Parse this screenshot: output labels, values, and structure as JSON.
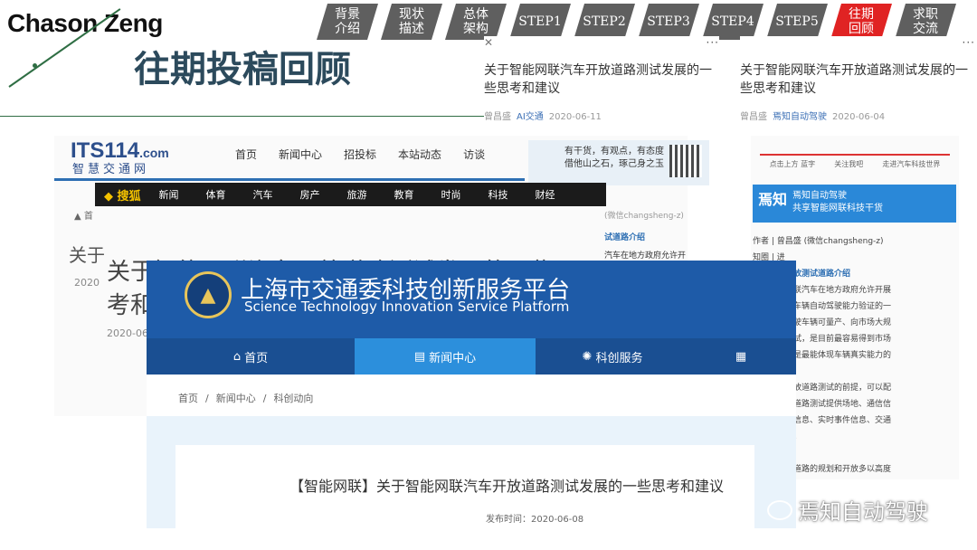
{
  "header": {
    "author": "Chason Zeng",
    "title": "往期投稿回顾"
  },
  "nav": {
    "tabs": [
      {
        "label": "背景\n介绍"
      },
      {
        "label": "现状\n描述"
      },
      {
        "label": "总体\n架构"
      },
      {
        "label": "STEP1"
      },
      {
        "label": "STEP2"
      },
      {
        "label": "STEP3"
      },
      {
        "label": "STEP4"
      },
      {
        "label": "STEP5"
      },
      {
        "label": "往期\n回顾",
        "active": true
      },
      {
        "label": "求职\n交流"
      }
    ],
    "active_color": "#e02323"
  },
  "top_cards": [
    {
      "title": "关于智能网联汽车开放道路测试发展的一些思考和建议",
      "author": "曾昌盛",
      "source": "AI交通",
      "date": "2020-06-11"
    },
    {
      "title": "关于智能网联汽车开放道路测试发展的一些思考和建议",
      "author": "曾昌盛",
      "source": "焉知自动驾驶",
      "date": "2020-06-04"
    }
  ],
  "its114": {
    "logo": "ITS114",
    "logo_suffix": ".com",
    "logo_cn": "智慧交通网",
    "menu": [
      "首页",
      "新闻中心",
      "招投标",
      "本站动态",
      "访谈"
    ],
    "ad_text": "有干货，有观点，有态度\n借他山之石，琢己身之玉",
    "breadcrumb": "首",
    "title_fragment": "关于",
    "date": "2020",
    "big_title_line1": "关于智能网联汽车开放道路测试发展的一些思",
    "big_title_line2": "考和",
    "date2": "2020-06"
  },
  "sohu": {
    "logo": "搜狐",
    "items": [
      "新闻",
      "体育",
      "汽车",
      "房产",
      "旅游",
      "教育",
      "时尚",
      "科技",
      "财经"
    ]
  },
  "right_column": {
    "author_line": "(微信changsheng-z)",
    "heading": "试道路介绍",
    "text": "汽车在地方政府允许开"
  },
  "yanzhi": {
    "flow": [
      "点击上方 蓝字",
      "关注我吧",
      "走进汽车科技世界"
    ],
    "banner_logo": "焉知",
    "banner_text": "焉知自动驾驶\n共享智能网联科技干货",
    "body": [
      {
        "text": "作者 | 曾昌盛 (微信changsheng-z)"
      },
      {
        "text": "知圈 | 进"
      },
      {
        "text": "路测试和开放测试道路介绍",
        "heading": true
      },
      {
        "text": "试是智能网联汽车在地方政府允许开展"
      },
      {
        "text": "区域内进行车辆自动驾驶能力验证的一"
      },
      {
        "text": "，是自动驾驶车辆可量产、向市场大规"
      },
      {
        "text": "的标志性测试，是目前最容易得到市场"
      },
      {
        "text": "的测试，也是最能体现车辆真实能力的"
      },
      {
        "text": ""
      },
      {
        "text": "路是进行开放道路测试的前提，可以配"
      },
      {
        "text": "平台为开放道路测试提供场地、通信信"
      },
      {
        "text": "息、红绿灯信息、实时事件信息、交通"
      },
      {
        "text": "气候信息等。"
      },
      {
        "text": ""
      },
      {
        "text": "对开放测试道路的规划和开放多以高度"
      }
    ]
  },
  "stis": {
    "logo_glyph": "▲",
    "name_cn": "上海市交通委科技创新服务平台",
    "name_en": "Science Technology Innovation Service Platform",
    "nav": [
      {
        "label": "首页",
        "icon": "home-icon"
      },
      {
        "label": "新闻中心",
        "icon": "document-icon",
        "selected": true
      },
      {
        "label": "科创服务",
        "icon": "lightbulb-icon"
      },
      {
        "label": "",
        "icon": "grid-icon"
      }
    ],
    "breadcrumb": [
      "首页",
      "新闻中心",
      "科创动向"
    ],
    "article_title": "【智能网联】关于智能网联汽车开放道路测试发展的一些思考和建议",
    "publish_date": "发布时间：2020-06-08"
  },
  "watermark": "焉知自动驾驶"
}
